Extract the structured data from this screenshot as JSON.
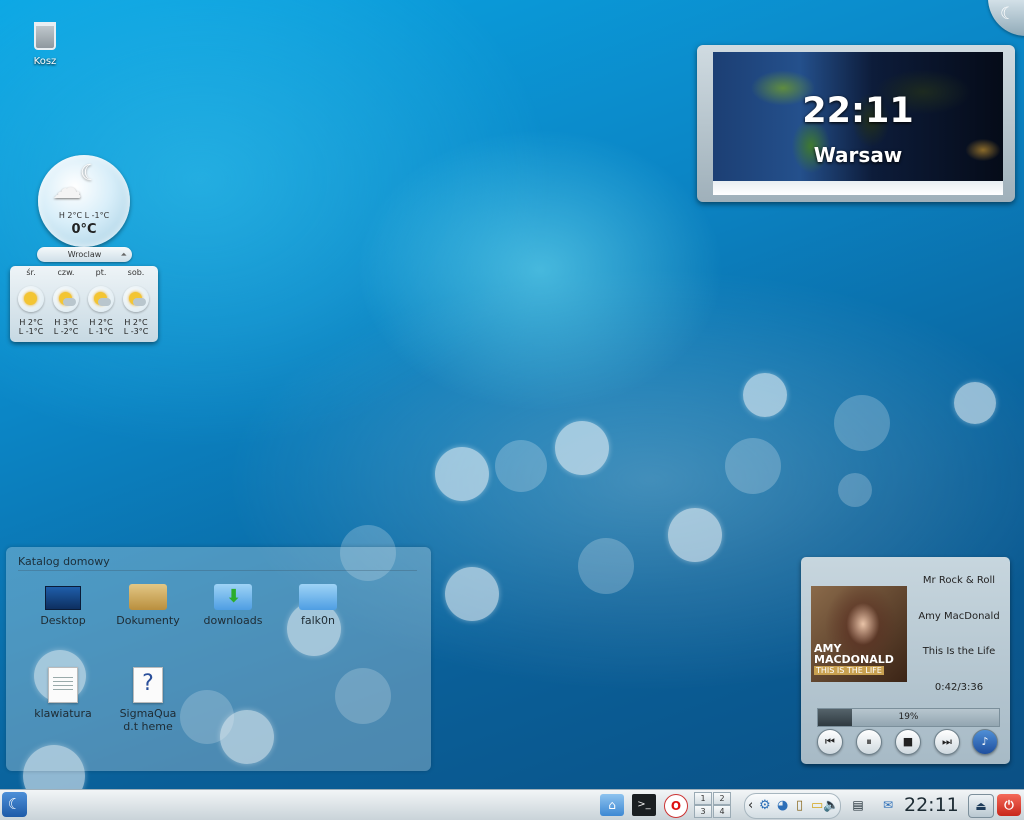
{
  "desktop": {
    "trash_label": "Kosz"
  },
  "weather": {
    "current_hilo": "H 2°C  L -1°C",
    "current_temp": "0°C",
    "city": "Wroclaw",
    "forecast": [
      {
        "day": "śr.",
        "high": "H 2°C",
        "low": "L -1°C"
      },
      {
        "day": "czw.",
        "high": "H 3°C",
        "low": "L -2°C"
      },
      {
        "day": "pt.",
        "high": "H 2°C",
        "low": "L -1°C"
      },
      {
        "day": "sob.",
        "high": "H 2°C",
        "low": "L -3°C"
      }
    ]
  },
  "world_clock": {
    "time": "22:11",
    "city": "Warsaw"
  },
  "folder_view": {
    "title": "Katalog domowy",
    "items": [
      {
        "name": "Desktop",
        "icon": "desktop-icon"
      },
      {
        "name": "Dokumenty",
        "icon": "folder-icon"
      },
      {
        "name": "downloads",
        "icon": "download-folder-icon"
      },
      {
        "name": "falk0n",
        "icon": "folder-icon"
      },
      {
        "name": "klawiatura",
        "icon": "text-file-icon"
      },
      {
        "name": "SigmaQuad.t heme",
        "icon": "unknown-file-icon"
      }
    ]
  },
  "player": {
    "title": "Mr Rock & Roll",
    "artist": "Amy MacDonald",
    "album": "This Is the Life",
    "position": "0:42/3:36",
    "progress_percent": "19%",
    "progress": 0.19,
    "album_art_text": "AMY MACDONALD",
    "album_art_subtext": "THIS IS THE LIFE"
  },
  "panel": {
    "clock": "22:11",
    "pager": [
      "1",
      "2",
      "3",
      "4"
    ]
  }
}
